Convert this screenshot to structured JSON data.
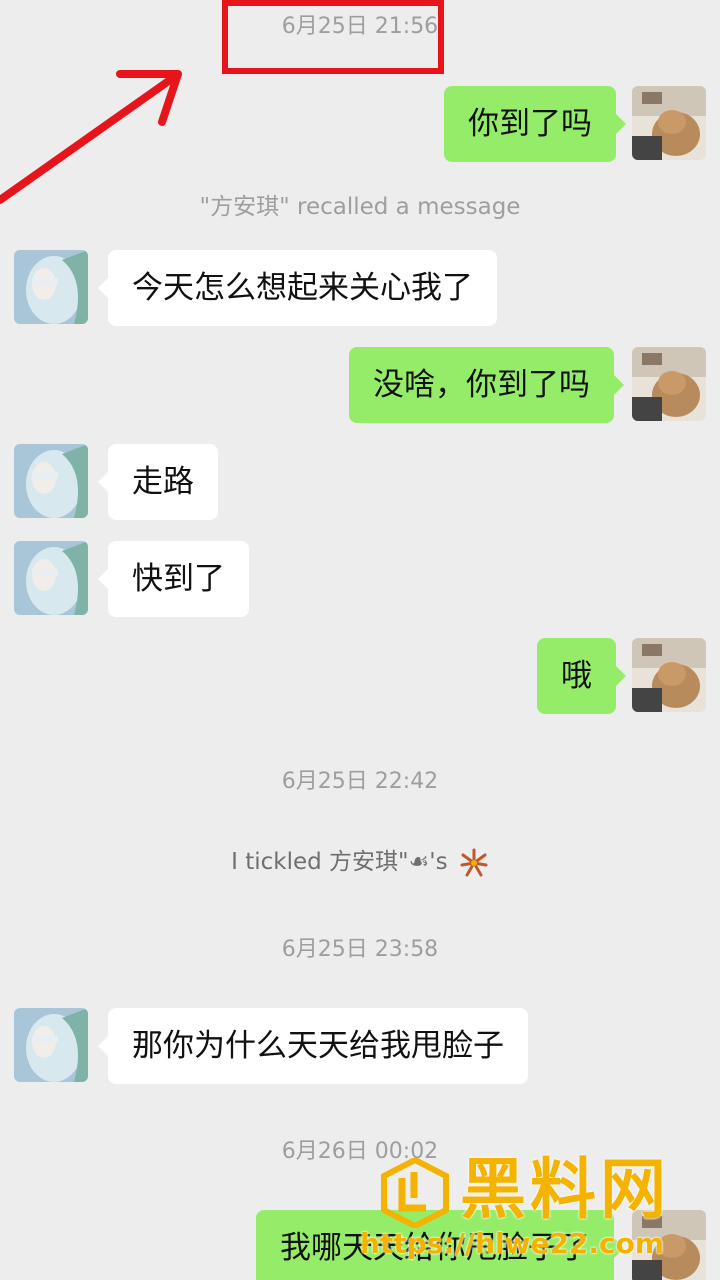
{
  "timestamps": {
    "t1": "6月25日 21:56",
    "t2": "6月25日 22:42",
    "t3": "6月25日 23:58",
    "t4": "6月26日 00:02"
  },
  "system": {
    "recalled": "\"方安琪\" recalled a message",
    "tickled": "I  tickled 方安琪\"☙'s"
  },
  "messages": {
    "m1": "你到了吗",
    "m2": "今天怎么想起来关心我了",
    "m3": "没啥，你到了吗",
    "m4": "走路",
    "m5": "快到了",
    "m6": "哦",
    "m7": "那你为什么天天给我甩脸子",
    "m8": "我哪天天给你甩脸子了"
  },
  "watermark": {
    "title": "黑料网",
    "url": "https://hlwe22.com"
  },
  "colors": {
    "background": "#ededed",
    "incoming_bubble": "#ffffff",
    "outgoing_bubble": "#95ec69",
    "annotation": "#e8141b",
    "watermark": "#f3b300"
  },
  "icons": {
    "self_avatar": "cat-avatar",
    "contact_avatar": "girl-avatar",
    "annotation_arrow": "red-arrow",
    "tickle_emoji": "firework-icon"
  }
}
